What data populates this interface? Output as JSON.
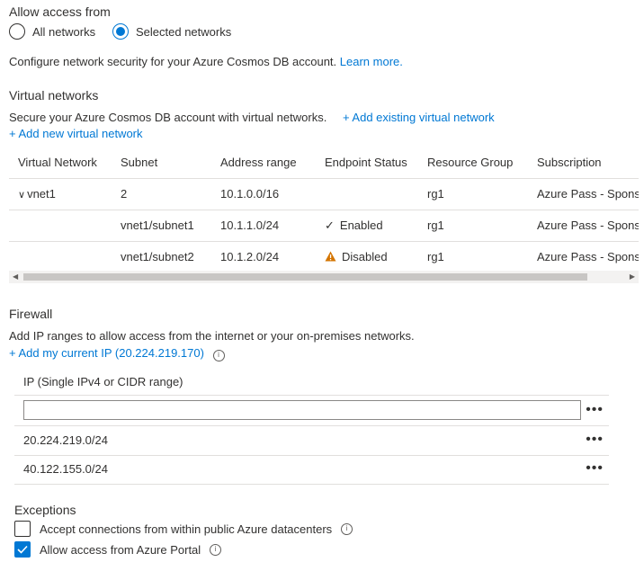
{
  "access": {
    "title": "Allow access from",
    "options": [
      "All networks",
      "Selected networks"
    ],
    "selected": "Selected networks"
  },
  "intro": {
    "text": "Configure network security for your Azure Cosmos DB account.",
    "learn_more": "Learn more."
  },
  "vnet": {
    "title": "Virtual networks",
    "description": "Secure your Azure Cosmos DB account with virtual networks.",
    "add_existing": "+ Add existing virtual network",
    "add_new": "+ Add new virtual network",
    "columns": [
      "Virtual Network",
      "Subnet",
      "Address range",
      "Endpoint Status",
      "Resource Group",
      "Subscription"
    ],
    "rows": [
      {
        "network": "vnet1",
        "subnet": "2",
        "address": "10.1.0.0/16",
        "status": "",
        "status_icon": "",
        "group": "rg1",
        "subscription": "Azure Pass - Sponsorship"
      },
      {
        "network": "",
        "subnet": "vnet1/subnet1",
        "address": "10.1.1.0/24",
        "status": "Enabled",
        "status_icon": "check-icon",
        "group": "rg1",
        "subscription": "Azure Pass - Sponsorship"
      },
      {
        "network": "",
        "subnet": "vnet1/subnet2",
        "address": "10.1.2.0/24",
        "status": "Disabled",
        "status_icon": "warning-icon",
        "group": "rg1",
        "subscription": "Azure Pass - Sponsorship"
      }
    ]
  },
  "firewall": {
    "title": "Firewall",
    "description": "Add IP ranges to allow access from the internet or your on-premises networks.",
    "add_current_ip": "+ Add my current IP (20.224.219.170)",
    "column": "IP (Single IPv4 or CIDR range)",
    "input_value": "",
    "ips": [
      "20.224.219.0/24",
      "40.122.155.0/24"
    ],
    "more_label": "•••"
  },
  "exceptions": {
    "title": "Exceptions",
    "items": [
      {
        "label": "Accept connections from within public Azure datacenters",
        "checked": false
      },
      {
        "label": "Allow access from Azure Portal",
        "checked": true
      }
    ]
  },
  "colors": {
    "accent": "#0078d4",
    "warning": "#d47500",
    "text": "#323130",
    "border": "#e1dfdd"
  }
}
